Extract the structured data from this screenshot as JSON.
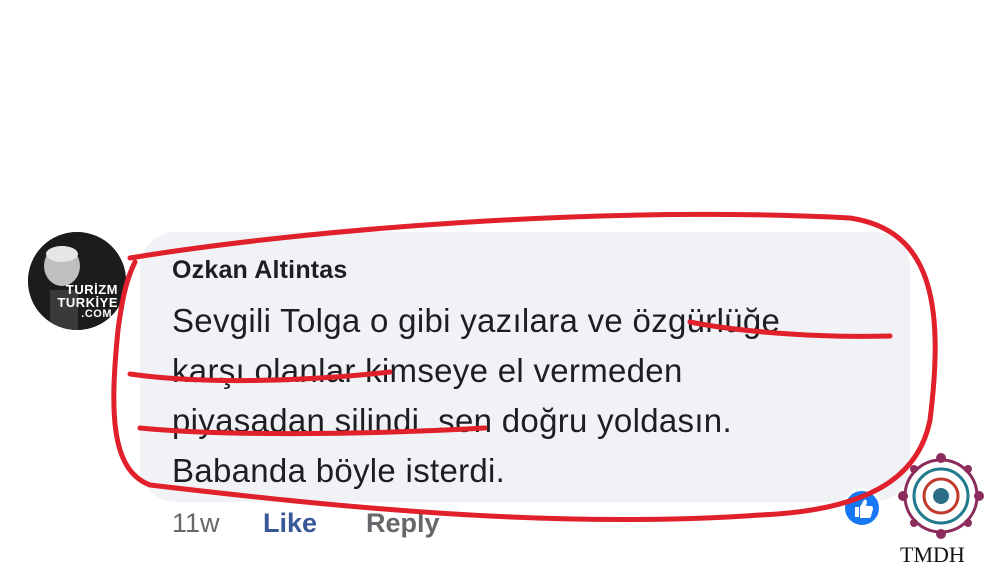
{
  "comment": {
    "author": "Ozkan Altintas",
    "text_lines": [
      "Sevgili Tolga o gibi yazılara ve özgürlüğe",
      "karşı olanlar kimseye el vermeden",
      "piyasadan silindi. sen doğru yoldasın.",
      "Babanda böyle isterdi."
    ],
    "avatar_text": [
      "TURİZM",
      "TURKİYE",
      ".COM"
    ]
  },
  "actions": {
    "time": "11w",
    "like": "Like",
    "reply": "Reply"
  },
  "watermark": {
    "name": "TMDH"
  },
  "colors": {
    "annotation": "#e0202a",
    "bubble": "#f0f2f5",
    "like": "#385898",
    "muted": "#65676b"
  }
}
